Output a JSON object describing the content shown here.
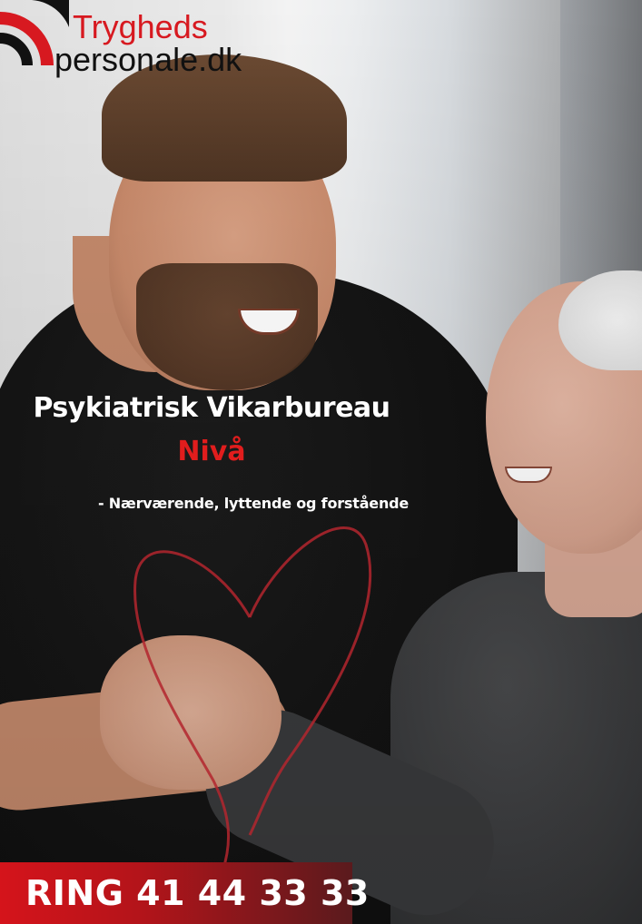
{
  "logo": {
    "line1": "Trygheds",
    "line2": "personale.dk"
  },
  "hero": {
    "title": "Psykiatrisk Vikarbureau",
    "city": "Nivå",
    "tagline": "- Nærværende, lyttende og forstående"
  },
  "cta": {
    "label": "RING 41 44 33 33"
  },
  "colors": {
    "brand_red": "#d71920",
    "cta_dark": "#5a1a1d",
    "heart_stroke": "#b3262e"
  },
  "icons": {
    "logo_mark": "logo-mark-icon",
    "heart": "heart-outline-icon"
  }
}
